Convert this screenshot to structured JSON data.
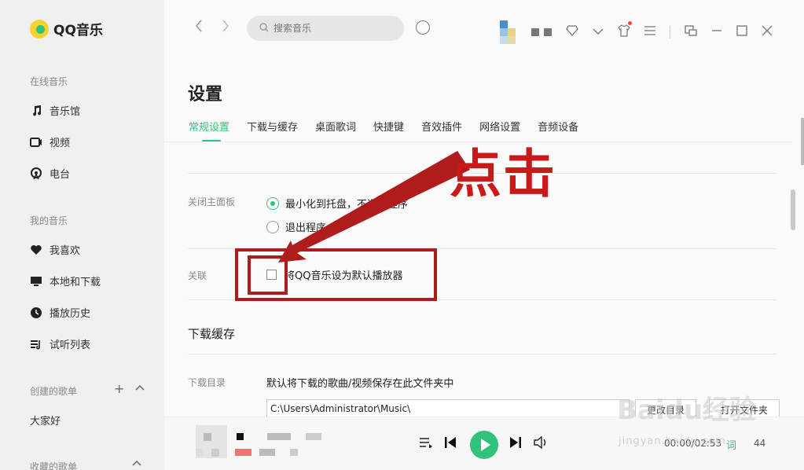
{
  "app": {
    "name": "QQ音乐"
  },
  "sidebar": {
    "online_title": "在线音乐",
    "online_items": [
      {
        "label": "音乐馆",
        "icon": "music-note-icon"
      },
      {
        "label": "视频",
        "icon": "video-icon"
      },
      {
        "label": "电台",
        "icon": "radio-icon"
      }
    ],
    "my_title": "我的音乐",
    "my_items": [
      {
        "label": "我喜欢",
        "icon": "heart-icon"
      },
      {
        "label": "本地和下载",
        "icon": "monitor-icon"
      },
      {
        "label": "播放历史",
        "icon": "history-icon"
      },
      {
        "label": "试听列表",
        "icon": "playlist-icon"
      }
    ],
    "created_title": "创建的歌单",
    "created_items": [
      {
        "label": "大家好"
      }
    ],
    "collected_title": "收藏的歌单"
  },
  "topbar": {
    "search_placeholder": "搜索音乐"
  },
  "settings": {
    "title": "设置",
    "tabs": [
      {
        "label": "常规设置",
        "active": true
      },
      {
        "label": "下载与缓存"
      },
      {
        "label": "桌面歌词"
      },
      {
        "label": "快捷键"
      },
      {
        "label": "音效插件"
      },
      {
        "label": "网络设置"
      },
      {
        "label": "音频设备"
      }
    ],
    "close_panel": {
      "label": "关闭主面板",
      "options": [
        {
          "label": "最小化到托盘，不退出程序",
          "selected": true
        },
        {
          "label": "退出程序",
          "selected": false
        }
      ]
    },
    "association": {
      "label": "关联",
      "checkbox_label": "将QQ音乐设为默认播放器",
      "checked": false
    },
    "download_cache": {
      "title": "下载缓存",
      "dir_label": "下载目录",
      "description": "默认将下载的歌曲/视频保存在此文件夹中",
      "path": "C:\\Users\\Administrator\\Music\\",
      "change_button": "更改目录",
      "open_button": "打开文件夹"
    }
  },
  "player": {
    "time": "00:00/02:53",
    "lyric": "词",
    "count": "44"
  },
  "annotation": {
    "text": "点击",
    "color": "#c91a1a"
  },
  "watermark": {
    "text": "Baidu经验",
    "sub": "jingyan.baidu.com"
  },
  "colors": {
    "accent": "#31c27c",
    "annotation": "#b01c1c"
  }
}
